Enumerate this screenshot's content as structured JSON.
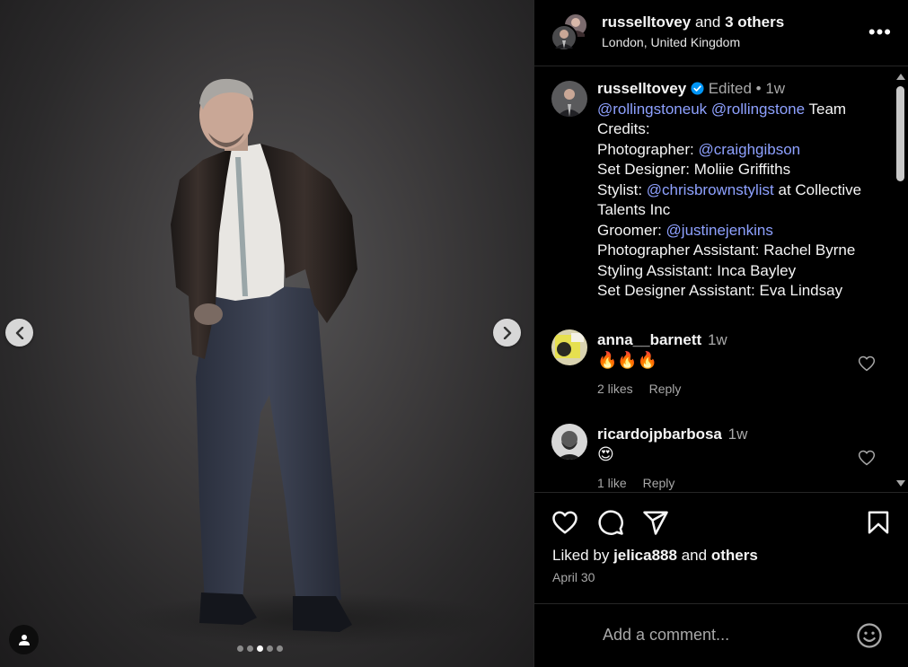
{
  "header": {
    "username": "russelltovey",
    "and_text": "and",
    "others_text": "3 others",
    "location": "London, United Kingdom",
    "more_label": "•••"
  },
  "caption": {
    "username": "russelltovey",
    "edited": "Edited",
    "separator": "•",
    "time": "1w",
    "mention1": "@rollingstoneuk",
    "mention2": "@rollingstone",
    "line1_tail": "Team",
    "line2": "Credits:",
    "photographer_label": "Photographer:",
    "photographer_mention": "@craighgibson",
    "set_designer": "Set Designer: Moliie Griffiths",
    "stylist_label": "Stylist:",
    "stylist_mention": "@chrisbrownstylist",
    "stylist_tail": "at Collective Talents Inc",
    "groomer_label": "Groomer:",
    "groomer_mention": "@justinejenkins",
    "photo_assistant": "Photographer Assistant: Rachel Byrne",
    "styling_assistant": "Styling Assistant: Inca Bayley",
    "set_assistant": "Set Designer Assistant: Eva Lindsay"
  },
  "comments": [
    {
      "username": "anna__barnett",
      "time": "1w",
      "text": "🔥🔥🔥",
      "likes": "2 likes",
      "reply": "Reply"
    },
    {
      "username": "ricardojpbarbosa",
      "time": "1w",
      "text": "😍",
      "likes": "1 like",
      "reply": "Reply"
    }
  ],
  "actions": {
    "liked_by": "Liked by",
    "liked_user": "jelica888",
    "and": "and",
    "others": "others",
    "date": "April 30"
  },
  "add_comment": {
    "placeholder": "Add a comment..."
  },
  "carousel": {
    "total": 5,
    "active_index": 2
  },
  "icons": [
    "chevron-left-icon",
    "chevron-right-icon",
    "user-tag-icon",
    "heart-icon",
    "comment-icon",
    "share-icon",
    "bookmark-icon",
    "emoji-icon",
    "verified-icon",
    "more-icon"
  ],
  "colors": {
    "background": "#000000",
    "mention": "#8ea1ff",
    "muted": "#a8a8a8",
    "verified": "#0095f6"
  }
}
